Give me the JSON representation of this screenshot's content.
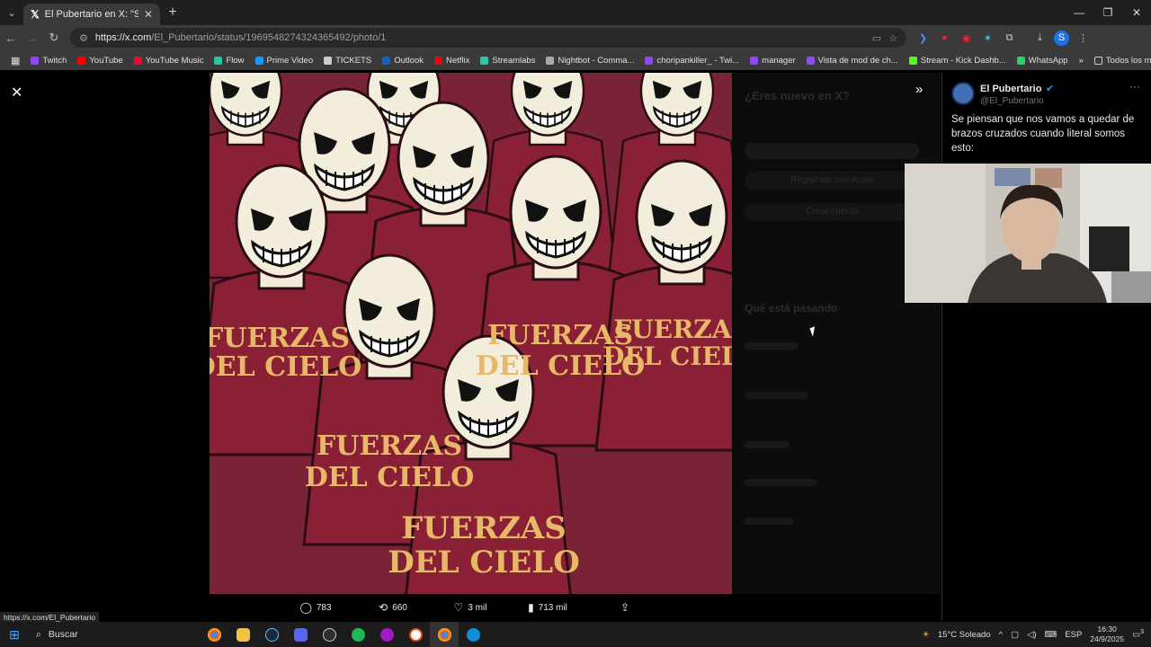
{
  "browser": {
    "tab_title": "El Pubertario en X: \"Se piensan",
    "url_host": "https://x.com",
    "url_path": "/El_Pubertario/status/1969548274324365492/photo/1",
    "bookmarks": [
      {
        "label": "Twitch",
        "color": "#9146ff"
      },
      {
        "label": "YouTube",
        "color": "#ff0000"
      },
      {
        "label": "YouTube Music",
        "color": "#ff0033"
      },
      {
        "label": "Flow",
        "color": "#27c5a5"
      },
      {
        "label": "Prime Video",
        "color": "#1a98ff"
      },
      {
        "label": "TICKETS",
        "color": "#cccccc"
      },
      {
        "label": "Outlook",
        "color": "#0a64c8"
      },
      {
        "label": "Netflix",
        "color": "#e50914"
      },
      {
        "label": "Streamlabs",
        "color": "#31c3a2"
      },
      {
        "label": "Nightbot - Comma...",
        "color": "#aaaaaa"
      },
      {
        "label": "choripankiller_ - Twi...",
        "color": "#9146ff"
      },
      {
        "label": "manager",
        "color": "#9146ff"
      },
      {
        "label": "Vista de mod de ch...",
        "color": "#9146ff"
      },
      {
        "label": "Stream - Kick Dashb...",
        "color": "#53fc18"
      },
      {
        "label": "WhatsApp",
        "color": "#25d366"
      }
    ],
    "bookmarks_overflow": "»",
    "all_bookmarks": "Todos los marcadores"
  },
  "viewer": {
    "shirt_text_line1": "FUERZAS",
    "shirt_text_line2": "DEL CIELO",
    "actions": {
      "replies": "783",
      "reposts": "660",
      "likes": "3 mil",
      "views": "713 mil"
    },
    "dim_panel": {
      "heading1": "¿Eres nuevo en X?",
      "button1": "Regístrate con Apple",
      "button2": "Crear cuenta",
      "heading2": "Qué está pasando"
    }
  },
  "status_url": "https://x.com/El_Pubertario",
  "tweet": {
    "author_name": "El Pubertario",
    "author_handle": "@El_Pubertario",
    "text": "Se piensan que nos vamos a quedar de brazos cruzados cuando literal somos esto:"
  },
  "taskbar": {
    "search_label": "Buscar",
    "weather": "15°C  Soleado",
    "lang": "ESP",
    "time": "16:30",
    "date": "24/9/2025",
    "notif_count": "3"
  }
}
